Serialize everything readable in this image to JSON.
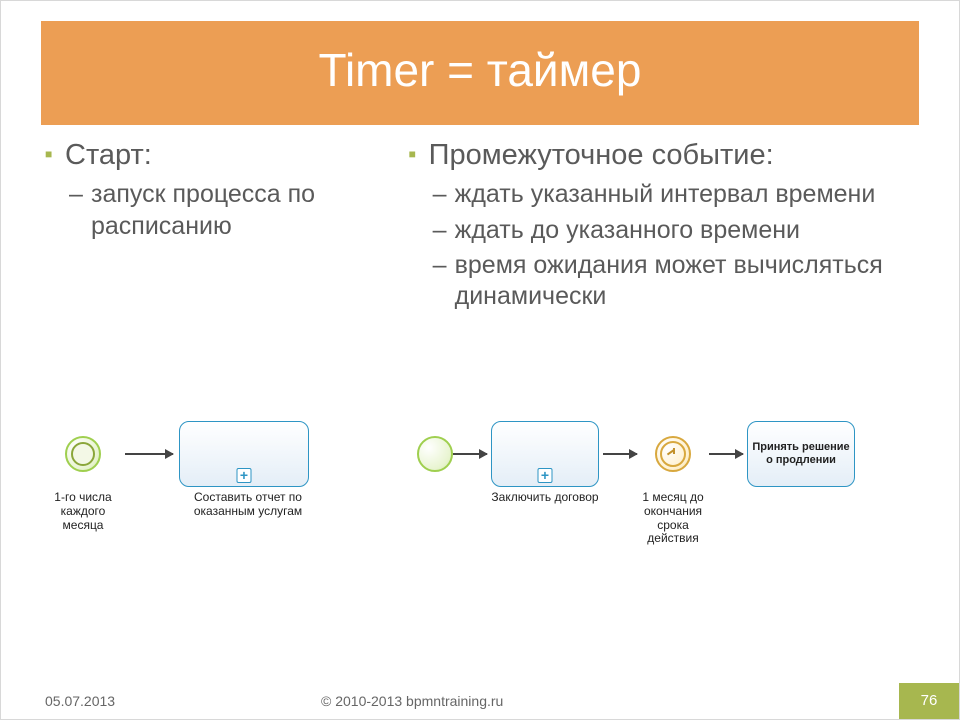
{
  "title": "Timer = таймер",
  "left": {
    "h": "Старт:",
    "items": [
      "запуск процесса по расписанию"
    ]
  },
  "right": {
    "h": "Промежуточное событие:",
    "items": [
      "ждать указанный интервал времени",
      "ждать до указанного времени",
      "время ожидания может вычисляться динамически"
    ]
  },
  "dia1": {
    "start_label": "1-го числа каждого месяца",
    "task_label": "Составить отчет по оказанным услугам"
  },
  "dia2": {
    "task1_label": "Заключить договор",
    "timer_label": "1 месяц до окончания срока действия",
    "task2_label": "Принять решение о продлении"
  },
  "footer": {
    "date": "05.07.2013",
    "copy": "© 2010-2013 bpmntraining.ru",
    "page": "76"
  }
}
